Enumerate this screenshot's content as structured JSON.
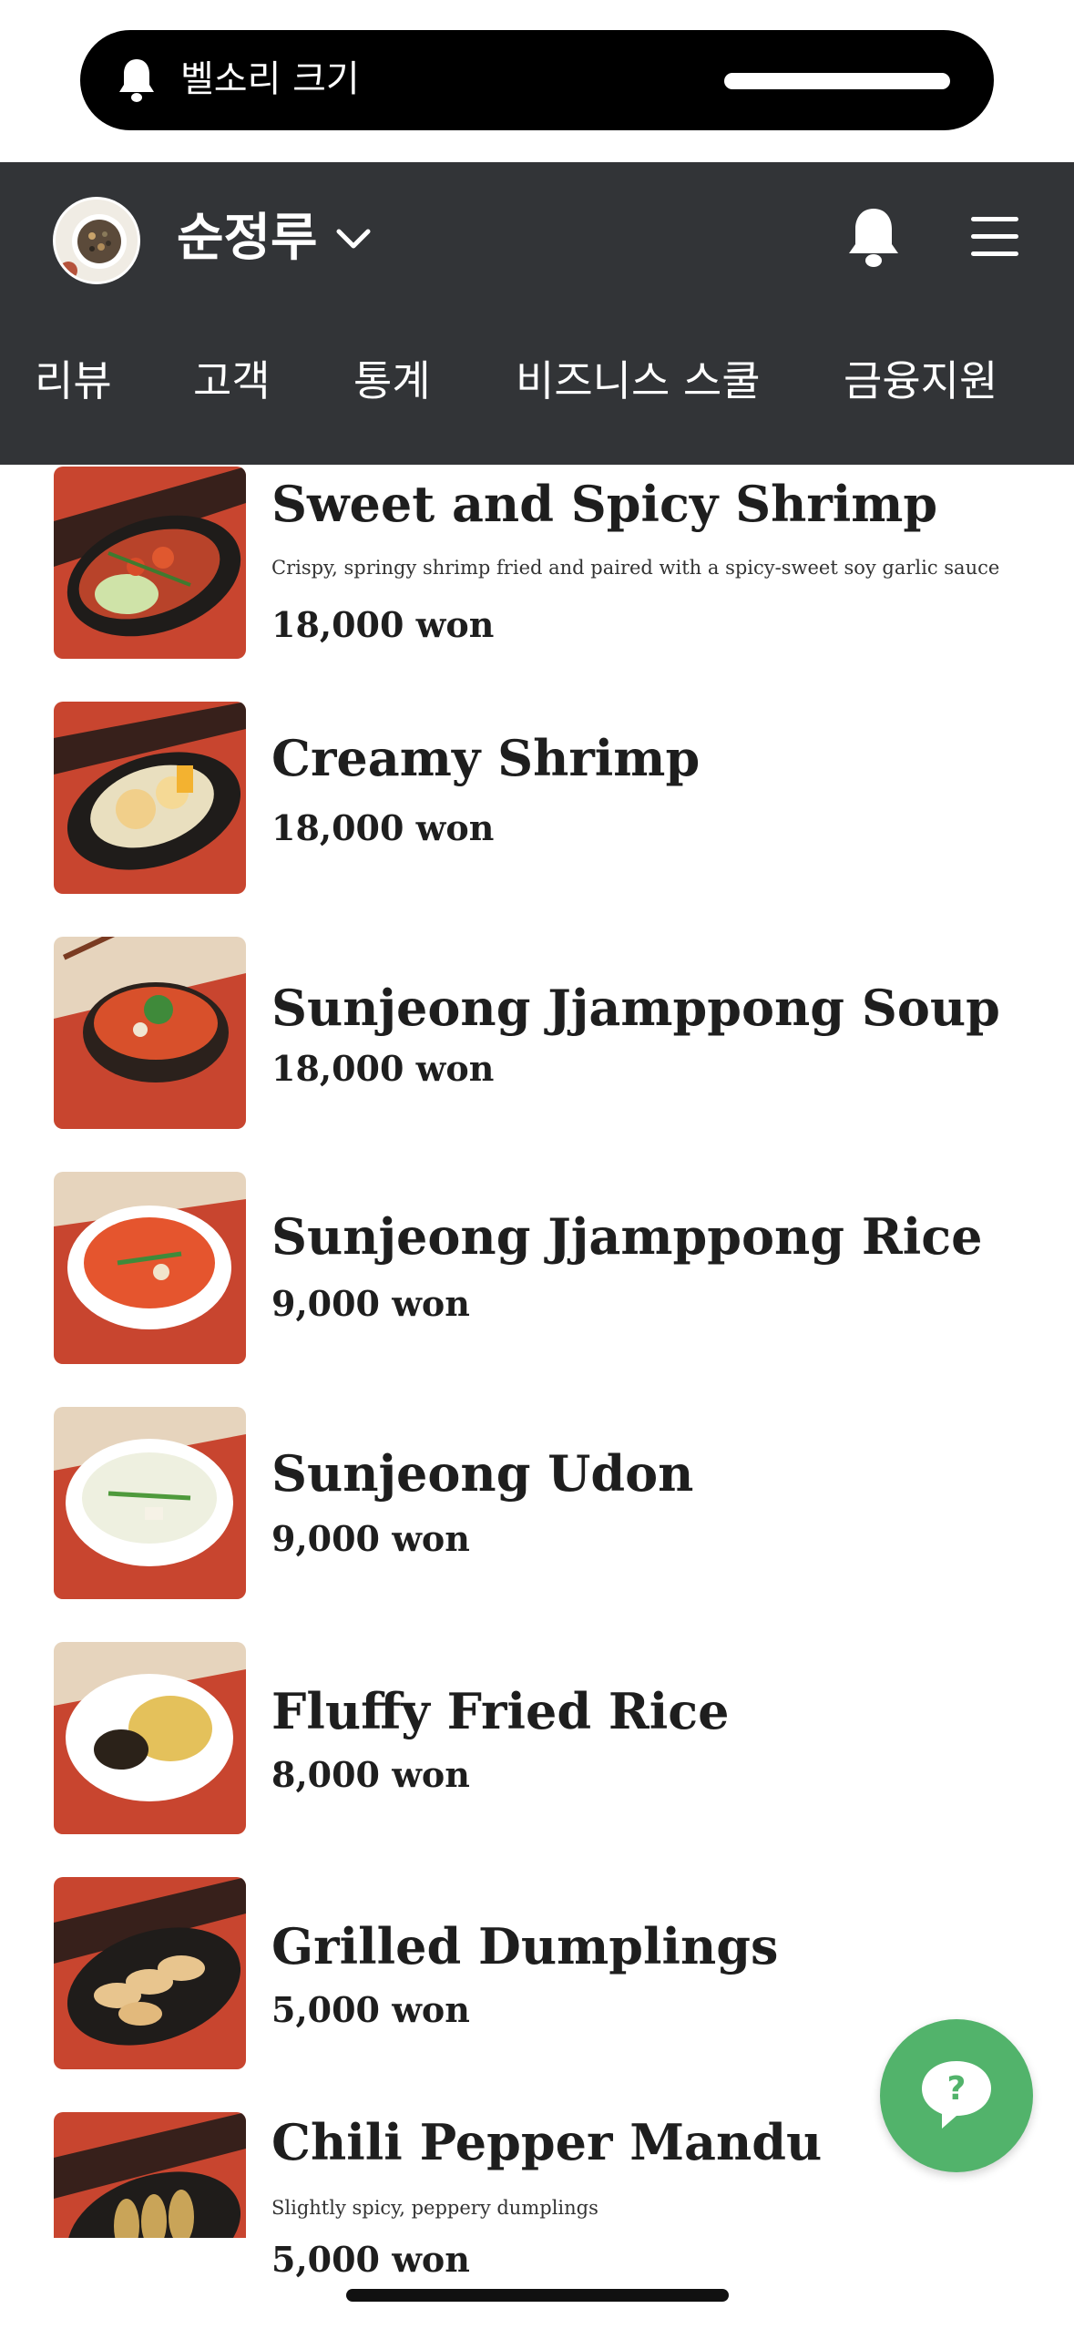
{
  "ringer": {
    "label": "벨소리 크기",
    "level": 1.0,
    "icon": "bell-icon"
  },
  "header": {
    "store_name": "순정루",
    "dropdown_icon": "chevron-down-icon",
    "notification_icon": "bell-icon",
    "menu_icon": "hamburger-menu-icon",
    "background": "#323437"
  },
  "tabs": [
    {
      "label": "리뷰"
    },
    {
      "label": "고객"
    },
    {
      "label": "통계"
    },
    {
      "label": "비즈니스 스쿨"
    },
    {
      "label": "금융지원"
    }
  ],
  "menu_items": [
    {
      "name": "Sweet and Spicy Shrimp",
      "description": "Crispy, springy shrimp fried and paired with a spicy-sweet soy garlic sauce",
      "price": "18,000 won"
    },
    {
      "name": "Creamy Shrimp",
      "description": "",
      "price": "18,000 won"
    },
    {
      "name": "Sunjeong Jjamppong Soup",
      "description": "",
      "price": "18,000 won"
    },
    {
      "name": "Sunjeong Jjamppong Rice",
      "description": "",
      "price": "9,000 won"
    },
    {
      "name": "Sunjeong Udon",
      "description": "",
      "price": "9,000 won"
    },
    {
      "name": "Fluffy Fried Rice",
      "description": "",
      "price": "8,000 won"
    },
    {
      "name": "Grilled Dumplings",
      "description": "",
      "price": "5,000 won"
    },
    {
      "name": "Chili Pepper Mandu",
      "description": "Slightly spicy, peppery dumplings",
      "price": "5,000 won"
    }
  ],
  "help_button": {
    "icon": "question-chat-icon",
    "color": "#52b36b"
  }
}
